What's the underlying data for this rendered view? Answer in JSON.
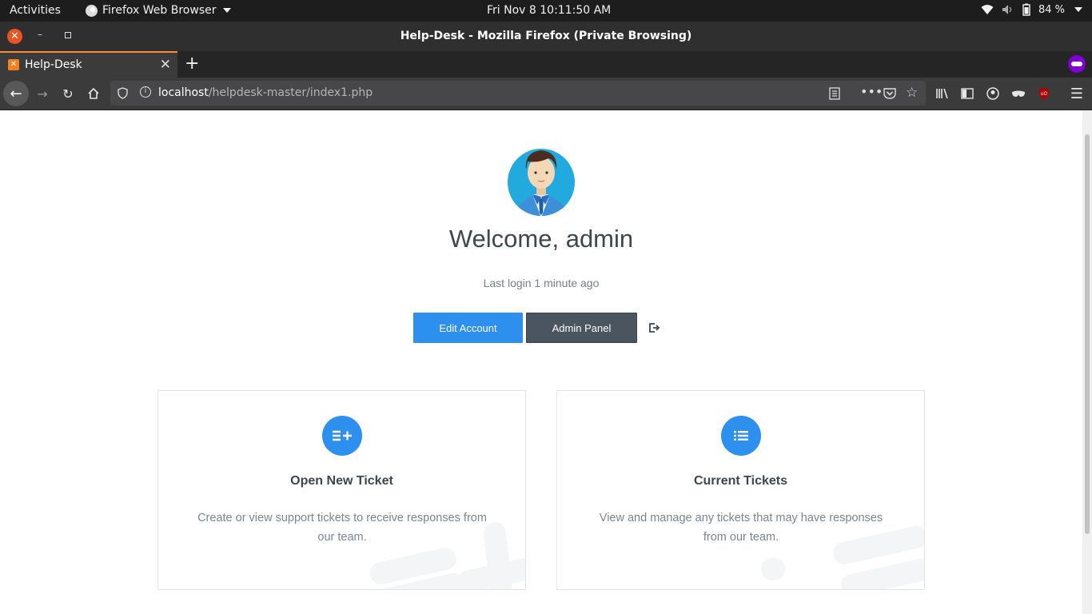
{
  "system": {
    "activities": "Activities",
    "app_menu": "Firefox Web Browser",
    "clock": "Fri Nov 8  10:11:50 AM",
    "battery": "84 %"
  },
  "window": {
    "title": "Help-Desk - Mozilla Firefox (Private Browsing)"
  },
  "tab": {
    "label": "Help-Desk",
    "favicon_text": "✕"
  },
  "urlbar": {
    "host": "localhost",
    "path": "/helpdesk-master/index1.php"
  },
  "profile": {
    "welcome": "Welcome, admin",
    "last_login": "Last login 1 minute ago",
    "edit_account": "Edit Account",
    "admin_panel": "Admin Panel"
  },
  "cards": [
    {
      "title": "Open New Ticket",
      "description": "Create or view support tickets to receive responses from our team.",
      "icon": "list-add-icon"
    },
    {
      "title": "Current Tickets",
      "description": "View and manage any tickets that may have responses from our team.",
      "icon": "list-icon"
    }
  ],
  "colors": {
    "accent": "#2d8fee",
    "dark_button": "#4a5560",
    "private": "#8000d7"
  }
}
